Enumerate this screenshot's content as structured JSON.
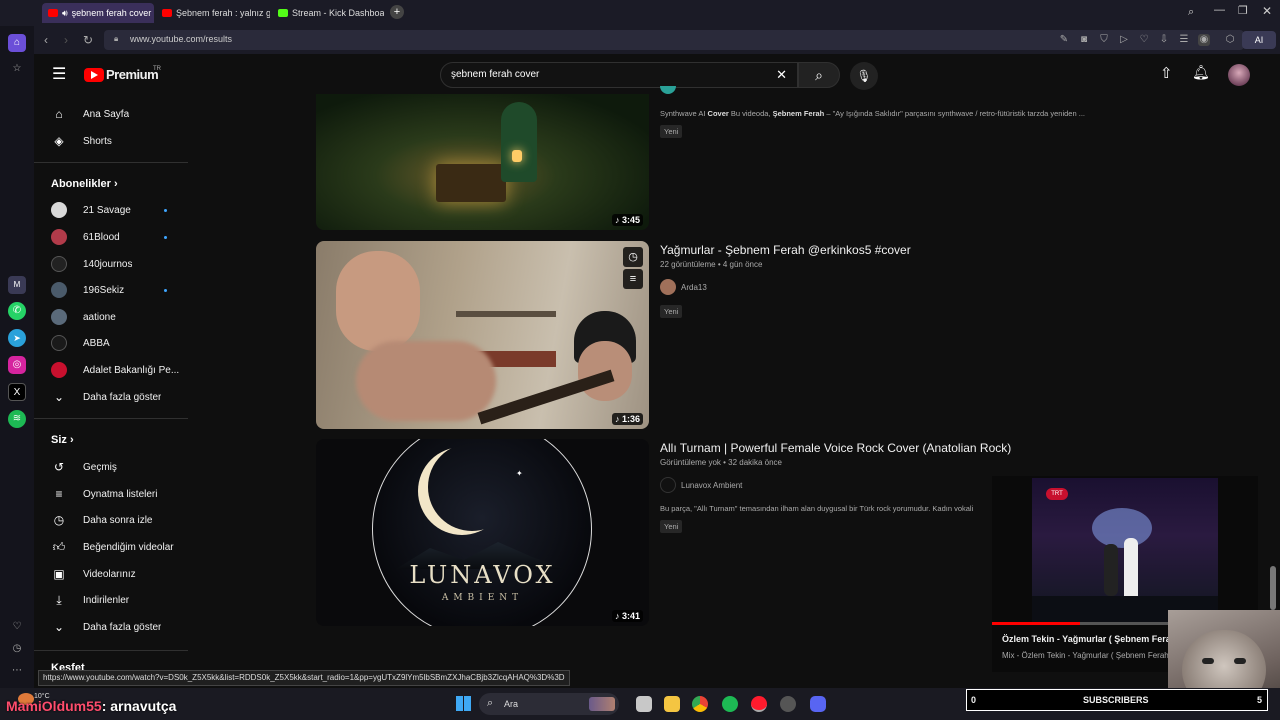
{
  "browser": {
    "tabs": [
      {
        "label": "şebnem ferah cover"
      },
      {
        "label": "Şebnem ferah : yalnız gita"
      },
      {
        "label": "Stream - Kick Dashboard"
      }
    ],
    "url": "www.youtube.com/results",
    "ai_label": "AI"
  },
  "header": {
    "logo_text": "Premium",
    "logo_region": "TR",
    "search_value": "şebnem ferah cover"
  },
  "guide": {
    "main": [
      {
        "label": "Ana Sayfa",
        "icon": "home-icon"
      },
      {
        "label": "Shorts",
        "icon": "shorts-icon"
      }
    ],
    "subs_title": "Abonelikler",
    "subs": [
      {
        "label": "21 Savage",
        "dot": true,
        "color": "#d9d9d9"
      },
      {
        "label": "61Blood",
        "dot": true,
        "color": "#b23b4a"
      },
      {
        "label": "140journos",
        "dot": false,
        "color": "#222222"
      },
      {
        "label": "196Sekiz",
        "dot": true,
        "color": "#4a5a6a"
      },
      {
        "label": "aatione",
        "dot": false,
        "color": "#5a6a7a"
      },
      {
        "label": "ABBA",
        "dot": false,
        "color": "#1a1a1a"
      },
      {
        "label": "Adalet Bakanlığı Pe...",
        "dot": false,
        "color": "#c8102e"
      }
    ],
    "show_more": "Daha fazla göster",
    "you_title": "Siz",
    "you": [
      {
        "label": "Geçmiş",
        "icon": "history-icon"
      },
      {
        "label": "Oynatma listeleri",
        "icon": "playlists-icon"
      },
      {
        "label": "Daha sonra izle",
        "icon": "watch-later-icon"
      },
      {
        "label": "Beğendiğim videolar",
        "icon": "like-icon"
      },
      {
        "label": "Videolarınız",
        "icon": "your-videos-icon"
      },
      {
        "label": "İndirilenler",
        "icon": "downloads-icon"
      }
    ],
    "show_more2": "Daha fazla göster",
    "explore_title": "Keşfet"
  },
  "results": [
    {
      "title": "",
      "description_prefix": "Synthwave AI ",
      "description_bold": "Cover",
      "description_mid": " Bu videoda, ",
      "description_bold2": "Şebnem Ferah",
      "description_rest": " – \"Ay Işığında Saklıdır\" parçasını synthwave / retro-fütüristik tarzda yeniden ...",
      "badge": "Yeni",
      "duration": "3:45"
    },
    {
      "title": "Yağmurlar - Şebnem Ferah @erkinkos5 #cover",
      "meta": "22 görüntüleme • 4 gün önce",
      "channel": "Arda13",
      "badge": "Yeni",
      "duration": "1:36"
    },
    {
      "title": "Allı Turnam | Powerful Female Voice Rock Cover (Anatolian Rock)",
      "meta": "Görüntüleme yok • 32 dakika önce",
      "channel": "Lunavox Ambient",
      "description": "Bu parça, \"Allı Turnam\" temasından ilham alan duygusal bir Türk rock yorumudur. Kadın vokali",
      "badge": "Yeni",
      "duration": "3:41",
      "thumb_title": "LUNAVOX",
      "thumb_subtitle": "AMBIENT"
    }
  ],
  "miniplayer": {
    "title": "Özlem Tekin - Yağmurlar ( Şebnem Fera",
    "subtitle": "Mix - Özlem Tekin - Yağmurlar ( Şebnem Ferah",
    "channel_logo": "TRT"
  },
  "status_url": "https://www.youtube.com/watch?v=DS0k_Z5X5kk&list=RDDS0k_Z5X5kk&start_radio=1&pp=ygUTxZ9lYm5lbSBmZXJhaCBjb3ZlcqAHAQ%3D%3D",
  "stream_overlay": {
    "chat_user": "MamiOldum55",
    "chat_message": ": arnavutça",
    "subs_left": "0",
    "subs_label": "SUBSCRIBERS",
    "subs_right": "5"
  },
  "taskbar": {
    "weather": "10°C",
    "search_label": "Ara"
  }
}
